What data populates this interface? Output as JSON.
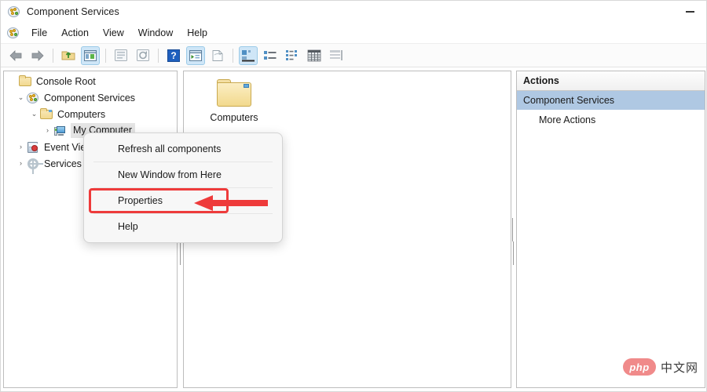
{
  "window": {
    "title": "Component Services",
    "icon": "component-services-icon",
    "minimize_label": "Minimize"
  },
  "menubar": {
    "icon": "component-services-icon",
    "items": [
      {
        "label": "File"
      },
      {
        "label": "Action"
      },
      {
        "label": "View"
      },
      {
        "label": "Window"
      },
      {
        "label": "Help"
      }
    ]
  },
  "toolbar": {
    "buttons": [
      {
        "name": "back-icon",
        "selected": false
      },
      {
        "name": "forward-icon",
        "selected": false
      },
      {
        "name": "up-folder-icon",
        "selected": false
      },
      {
        "name": "show-hide-console-tree-icon",
        "selected": true
      },
      {
        "name": "properties-icon",
        "selected": false
      },
      {
        "name": "refresh-icon",
        "selected": false
      },
      {
        "name": "help-icon",
        "selected": false
      },
      {
        "name": "export-list-icon",
        "selected": true
      },
      {
        "name": "new-window-icon",
        "selected": false
      },
      {
        "name": "view-large-icons-icon",
        "selected": true
      },
      {
        "name": "view-small-icons-icon",
        "selected": false
      },
      {
        "name": "view-list-icon",
        "selected": false
      },
      {
        "name": "view-details-icon",
        "selected": false
      },
      {
        "name": "view-report-icon",
        "selected": false
      }
    ]
  },
  "tree": {
    "items": [
      {
        "label": "Console Root",
        "icon": "folder-icon",
        "indent": 0,
        "chevron": "",
        "selected": false
      },
      {
        "label": "Component Services",
        "icon": "component-services-icon",
        "indent": 1,
        "chevron": "expanded",
        "selected": false
      },
      {
        "label": "Computers",
        "icon": "folder-icon",
        "indent": 2,
        "chevron": "expanded",
        "selected": false
      },
      {
        "label": "My Computer",
        "icon": "my-computer-icon",
        "indent": 3,
        "chevron": "collapsed",
        "selected": true
      },
      {
        "label": "Event Viewer (Local)",
        "icon": "event-viewer-icon",
        "indent": 1,
        "chevron": "collapsed",
        "selected": false
      },
      {
        "label": "Services (Local)",
        "icon": "services-icon",
        "indent": 1,
        "chevron": "collapsed",
        "selected": false
      }
    ]
  },
  "main_pane": {
    "items": [
      {
        "label": "Computers",
        "icon": "folder-icon"
      }
    ]
  },
  "actions_pane": {
    "header": "Actions",
    "root_item": "Component Services",
    "sub_items": [
      {
        "label": "More Actions"
      }
    ]
  },
  "context_menu": {
    "items": [
      {
        "label": "Refresh all components",
        "highlighted": false
      },
      {
        "label": "New Window from Here",
        "highlighted": false
      },
      {
        "label": "Properties",
        "highlighted": true
      },
      {
        "label": "Help",
        "highlighted": false
      }
    ]
  },
  "annotations": {
    "arrow_color": "#ee3b3b",
    "highlight_color": "#ee3b3b",
    "arrow_target": "Properties"
  },
  "watermark": {
    "badge": "php",
    "text": "中文网"
  },
  "colors": {
    "selection_blue": "#afc8e3",
    "toolbar_selected": "#cfe6f7",
    "tree_selected": "#e4e4e4",
    "accent_red": "#ee3b3b"
  }
}
